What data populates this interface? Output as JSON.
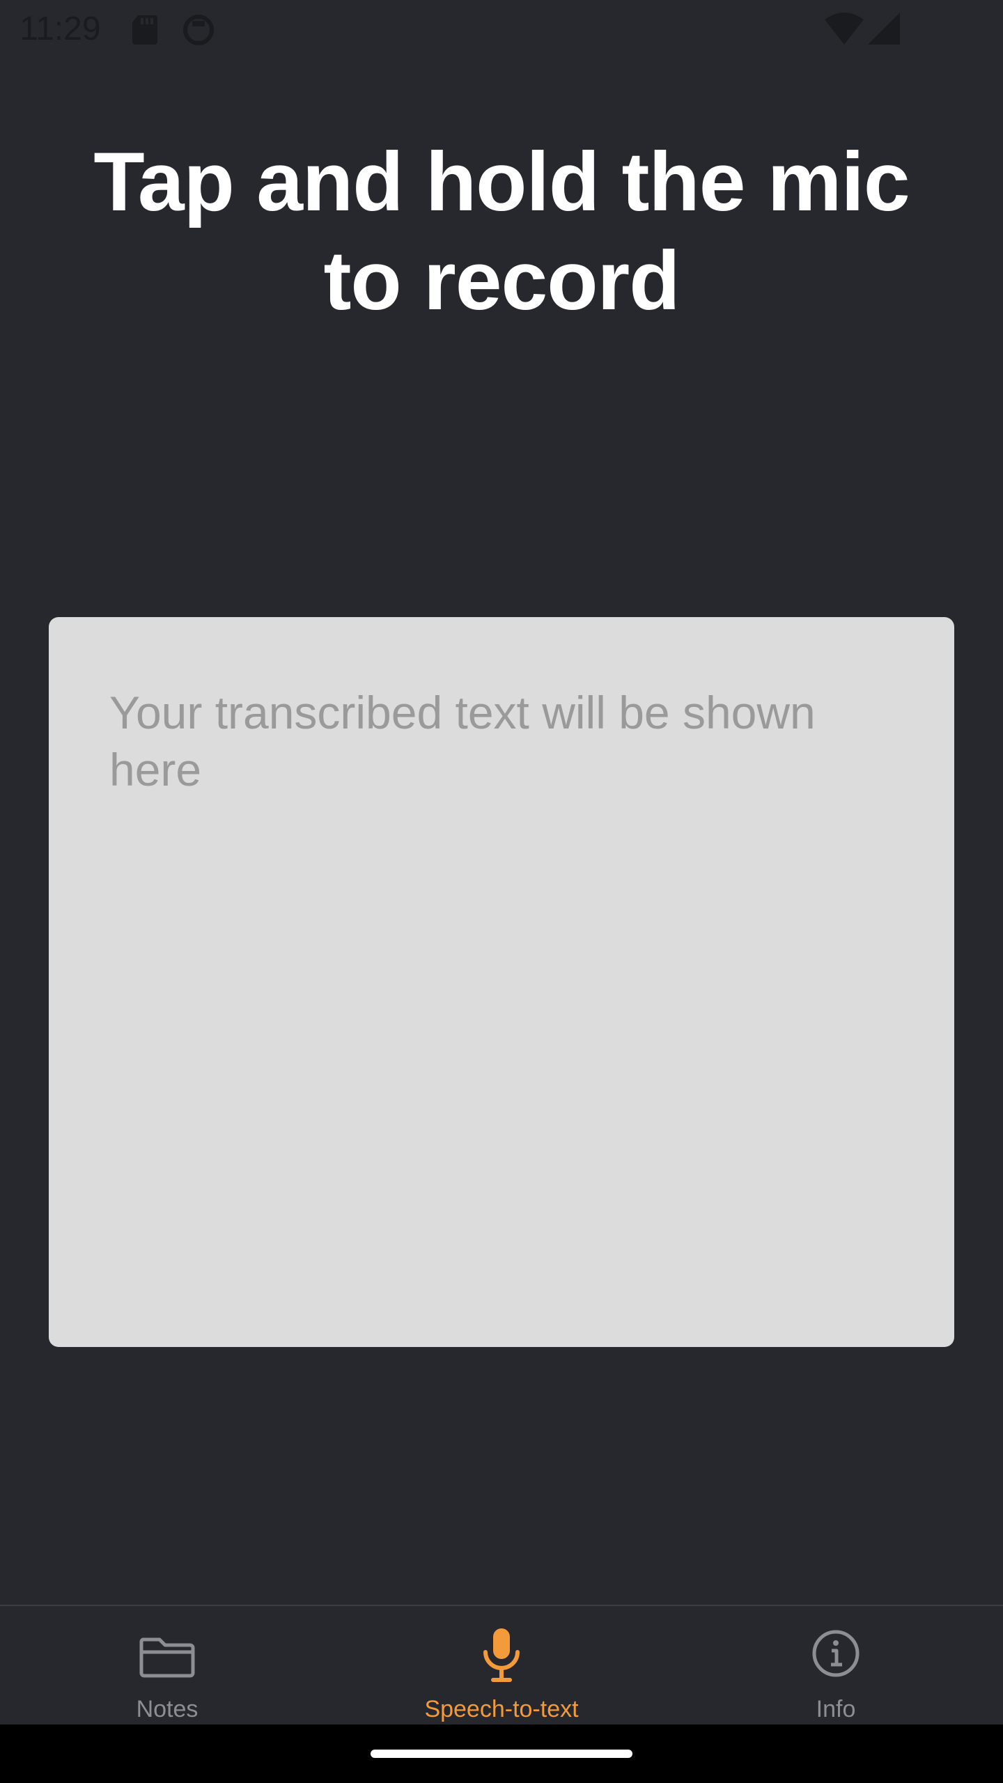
{
  "status_bar": {
    "time": "11:29",
    "icons": [
      "sd-card-icon",
      "media-icon",
      "wifi-icon",
      "signal-icon"
    ]
  },
  "main": {
    "heading": "Tap and hold the mic to record",
    "transcript_placeholder": "Your transcribed text will be shown here"
  },
  "bottom_nav": {
    "items": [
      {
        "label": "Notes",
        "icon": "folder-icon",
        "active": false
      },
      {
        "label": "Speech-to-text",
        "icon": "microphone-icon",
        "active": true
      },
      {
        "label": "Info",
        "icon": "info-icon",
        "active": false
      }
    ]
  },
  "colors": {
    "background": "#26282e",
    "card": "#dcdcdc",
    "placeholder_text": "#9a9a9a",
    "accent": "#f39a3b",
    "inactive": "#8c8e94",
    "status_bar_text": "#1a1b1f"
  }
}
